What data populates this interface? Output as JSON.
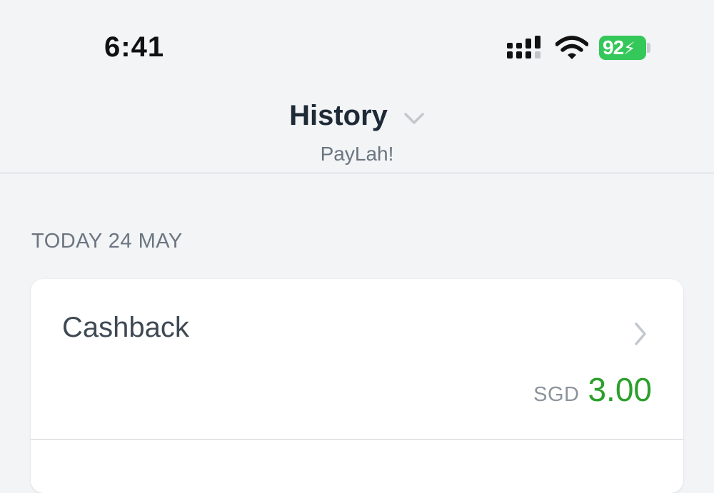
{
  "status_bar": {
    "time": "6:41",
    "battery_level": "92",
    "icons": [
      "signal-icon",
      "wifi-icon",
      "battery-icon"
    ]
  },
  "header": {
    "title": "History",
    "subtitle": "PayLah!",
    "dropdown_icon": "chevron-down-icon"
  },
  "sections": [
    {
      "date_label": "TODAY 24 MAY",
      "transactions": [
        {
          "title": "Cashback",
          "currency": "SGD",
          "amount": "3.00",
          "amount_color": "#2aa02a"
        }
      ]
    }
  ],
  "colors": {
    "background": "#f2f4f6",
    "battery": "#34c759",
    "positive_amount": "#2aa02a"
  }
}
